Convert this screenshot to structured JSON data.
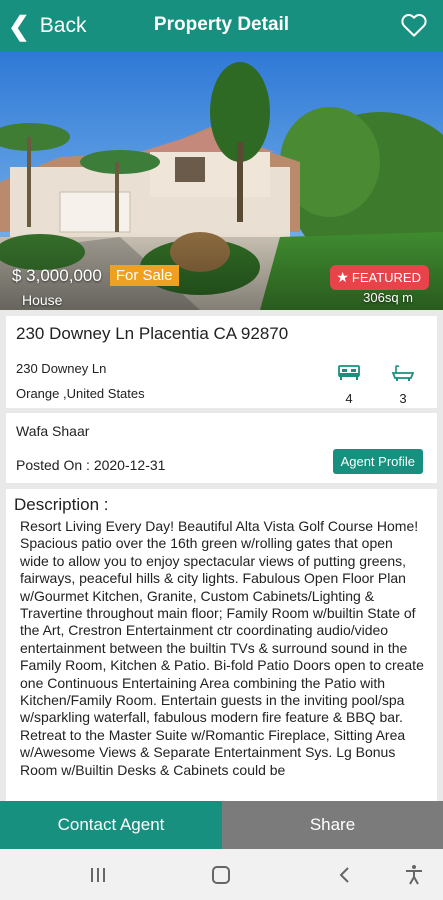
{
  "header": {
    "back_label": "Back",
    "title": "Property Detail",
    "back_icon": "chevron-left-icon",
    "favorite_icon": "heart-outline-icon"
  },
  "listing": {
    "price": "$ 3,000,000",
    "status": "For Sale",
    "property_type": "House",
    "featured_label": "FEATURED",
    "area": "306sq m",
    "address_title": "230 Downey Ln Placentia CA 92870",
    "street": "230 Downey Ln",
    "region": "Orange ,United States",
    "bedrooms": "4",
    "bathrooms": "3"
  },
  "agent": {
    "name": "Wafa Shaar",
    "posted_on": "Posted On : 2020-12-31",
    "profile_button": "Agent Profile"
  },
  "description": {
    "title": "Description :",
    "text": "Resort Living Every Day! Beautiful Alta Vista Golf Course Home! Spacious patio over the 16th green w/rolling gates that open wide to allow you to enjoy spectacular views of putting greens, fairways, peaceful hills & city lights. Fabulous Open Floor Plan w/Gourmet Kitchen, Granite, Custom Cabinets/Lighting & Travertine throughout main floor; Family Room w/builtin State of the Art, Crestron Entertainment ctr coordinating audio/video entertainment between the builtin TVs & surround sound in the Family Room, Kitchen & Patio. Bi-fold Patio Doors open to create one Continuous Entertaining Area combining the Patio with Kitchen/Family Room. Entertain guests in the inviting pool/spa w/sparkling waterfall, fabulous modern fire feature & BBQ bar. Retreat to the Master Suite w/Romantic Fireplace, Sitting Area w/Awesome Views & Separate Entertainment Sys. Lg Bonus Room w/Builtin Desks & Cabinets could be"
  },
  "actions": {
    "contact_label": "Contact Agent",
    "share_label": "Share"
  },
  "system_nav": {
    "recents_icon": "recent-apps-icon",
    "home_icon": "home-icon",
    "back_icon": "back-icon",
    "accessibility_icon": "accessibility-icon"
  },
  "colors": {
    "accent": "#17907f",
    "for_sale_badge": "#f0a021",
    "featured_badge": "#e8434b",
    "share_button": "#7b7b7b"
  }
}
